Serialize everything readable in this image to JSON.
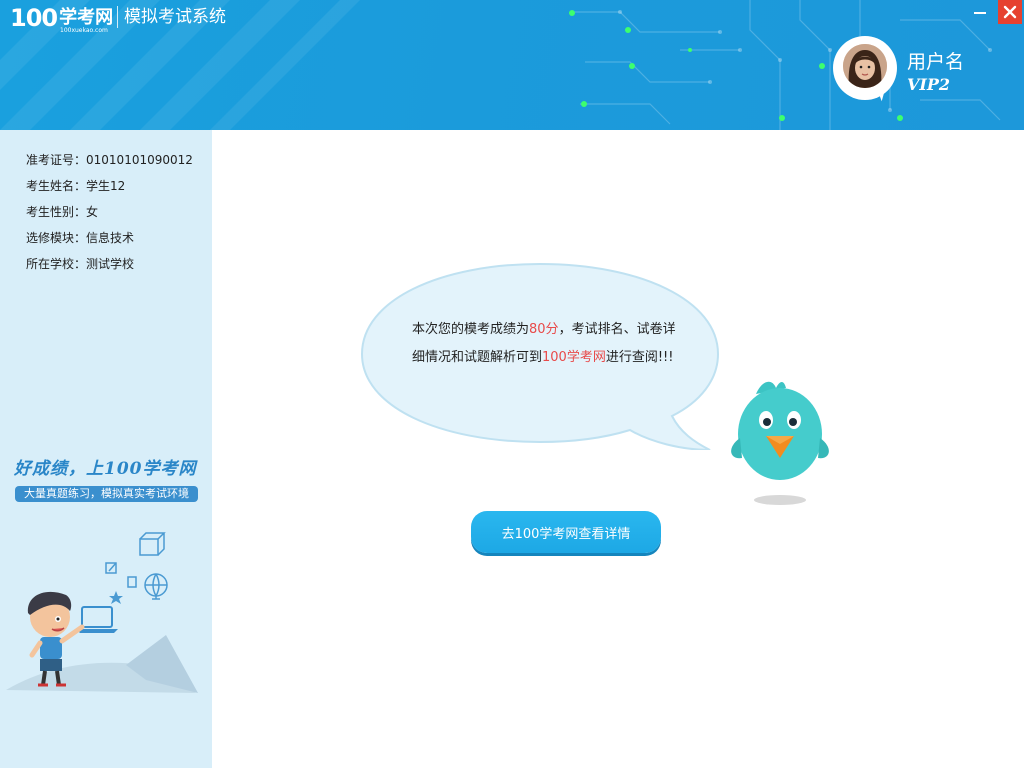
{
  "header": {
    "logo_number": "100",
    "logo_text": "学考网",
    "logo_domain": "100xuekao.com",
    "app_title": "模拟考试系统",
    "user": {
      "name": "用户名",
      "level": "VIP2"
    },
    "window_controls": {
      "minimize_icon": "minimize-icon",
      "close_icon": "close-icon"
    }
  },
  "sidebar": {
    "info": [
      {
        "label": "准考证号：",
        "value": "01010101090012"
      },
      {
        "label": "考生姓名：",
        "value": "学生12"
      },
      {
        "label": "考生性别：",
        "value": "女"
      },
      {
        "label": "选修模块：",
        "value": "信息技术"
      },
      {
        "label": "所在学校：",
        "value": "测试学校"
      }
    ],
    "slogan": "好成绩，上100学考网",
    "slogan_sub": "大量真题练习，模拟真实考试环境"
  },
  "main": {
    "message": {
      "part1": "本次您的模考成绩为",
      "score": "80分",
      "part2": "，考试排名、试卷详细情况和试题解析可到",
      "site": "100学考网",
      "part3": "进行查阅!!!"
    },
    "cta_label": "去100学考网查看详情"
  },
  "colors": {
    "header_blue": "#1b9bdb",
    "sidebar_bg": "#d8eef9",
    "highlight": "#e84a4a",
    "button": "#22b0ea",
    "close_red": "#e6412f"
  }
}
